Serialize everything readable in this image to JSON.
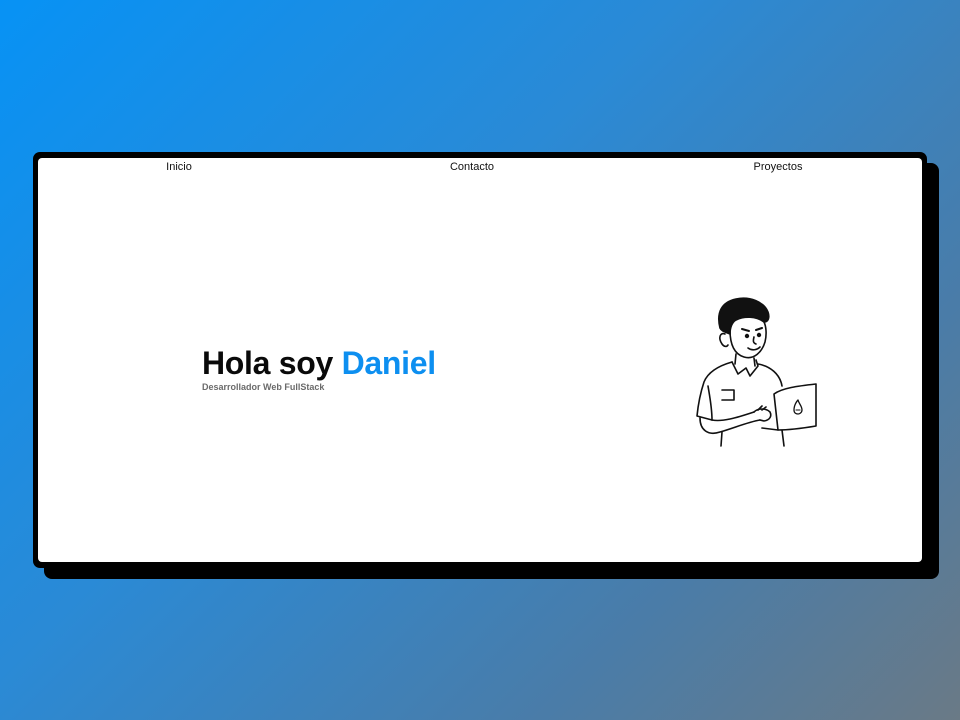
{
  "nav": {
    "items": [
      {
        "label": "Inicio"
      },
      {
        "label": "Contacto"
      },
      {
        "label": "Proyectos"
      }
    ]
  },
  "hero": {
    "greeting": "Hola soy",
    "name": "Daniel",
    "subtitle": "Desarrollador Web FullStack"
  },
  "colors": {
    "accent": "#0d8ff0",
    "text": "#0a0a0a",
    "subtitle": "#6b6b6b",
    "card_border": "#000000",
    "card_background": "#ffffff"
  },
  "illustration": {
    "icon": "developer-with-laptop-illustration"
  }
}
